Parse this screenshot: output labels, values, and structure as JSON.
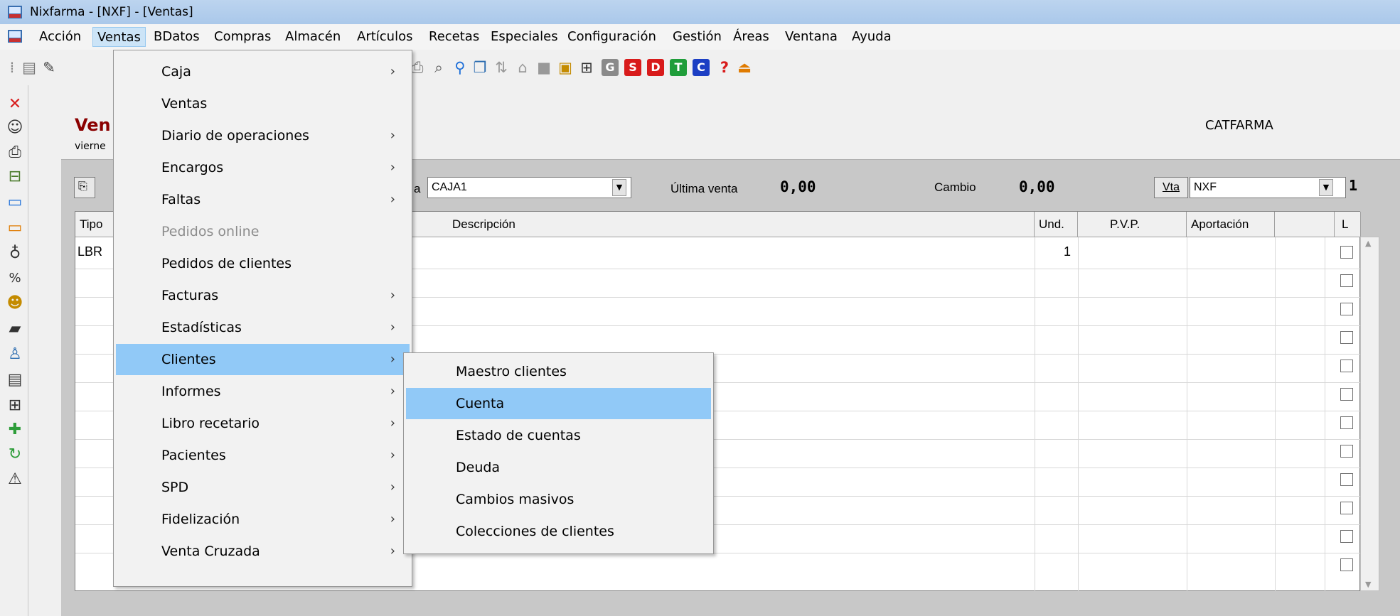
{
  "window": {
    "title": "Nixfarma - [NXF] - [Ventas]"
  },
  "menubar": {
    "items": [
      "Acción",
      "Ventas",
      "BDatos",
      "Compras",
      "Almacén",
      "Artículos",
      "Recetas",
      "Especiales",
      "Configuración",
      "Gestión",
      "Áreas",
      "Ventana",
      "Ayuda"
    ]
  },
  "toolbar": {
    "badges": [
      "G",
      "S",
      "D",
      "T",
      "C"
    ],
    "help": "?"
  },
  "document": {
    "title_fragment": "Ven",
    "date_fragment": "vierne",
    "company": "CATFARMA",
    "caja_label_fragment": "a",
    "caja_value": "CAJA1",
    "ultima_venta_label": "Última venta",
    "ultima_venta_value": "0,00",
    "cambio_label": "Cambio",
    "cambio_value": "0,00",
    "vta_button": "Vta",
    "vta_value": "NXF",
    "vta_count": "1"
  },
  "grid": {
    "columns": [
      "Tipo",
      "Descripción",
      "Und.",
      "P.V.P.",
      "Aportación",
      "",
      "L"
    ],
    "rows": [
      {
        "tipo": "LBR",
        "und": "1"
      }
    ]
  },
  "ventas_menu": {
    "items": [
      {
        "label": "Caja",
        "submenu": true,
        "disabled": false
      },
      {
        "label": "Ventas",
        "submenu": false,
        "disabled": false
      },
      {
        "label": "Diario de operaciones",
        "submenu": true,
        "disabled": false
      },
      {
        "label": "Encargos",
        "submenu": true,
        "disabled": false
      },
      {
        "label": "Faltas",
        "submenu": true,
        "disabled": false
      },
      {
        "label": "Pedidos online",
        "submenu": false,
        "disabled": true
      },
      {
        "label": "Pedidos de clientes",
        "submenu": false,
        "disabled": false
      },
      {
        "label": "Facturas",
        "submenu": true,
        "disabled": false
      },
      {
        "label": "Estadísticas",
        "submenu": true,
        "disabled": false
      },
      {
        "label": "Clientes",
        "submenu": true,
        "disabled": false,
        "highlighted": true
      },
      {
        "label": "Informes",
        "submenu": true,
        "disabled": false
      },
      {
        "label": "Libro recetario",
        "submenu": true,
        "disabled": false
      },
      {
        "label": "Pacientes",
        "submenu": true,
        "disabled": false
      },
      {
        "label": "SPD",
        "submenu": true,
        "disabled": false
      },
      {
        "label": "Fidelización",
        "submenu": true,
        "disabled": false
      },
      {
        "label": "Venta Cruzada",
        "submenu": true,
        "disabled": false
      }
    ]
  },
  "clientes_submenu": {
    "items": [
      {
        "label": "Maestro clientes"
      },
      {
        "label": "Cuenta",
        "highlighted": true
      },
      {
        "label": "Estado de cuentas"
      },
      {
        "label": "Deuda"
      },
      {
        "label": "Cambios masivos"
      },
      {
        "label": "Colecciones de clientes"
      }
    ]
  },
  "colors": {
    "highlight": "#91c9f7",
    "doc_title": "#8b0000",
    "badge_g": "#8a8a8a",
    "badge_s": "#d81b1b",
    "badge_d": "#d81b1b",
    "badge_t": "#1f9d3a",
    "badge_c": "#1c3fc4"
  }
}
